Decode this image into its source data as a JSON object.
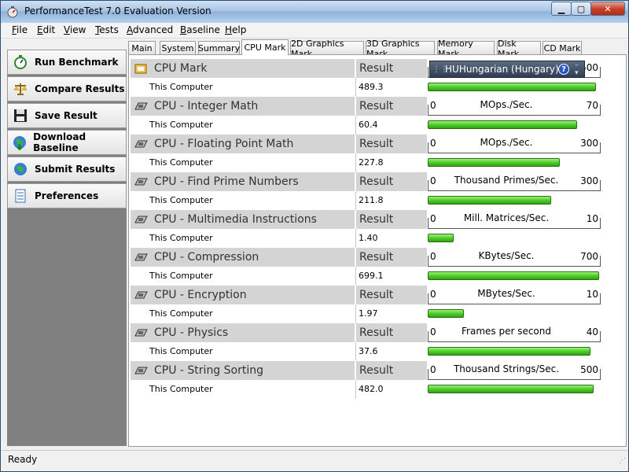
{
  "window": {
    "title": "PerformanceTest 7.0 Evaluation Version"
  },
  "menu": [
    {
      "key": "F",
      "rest": "ile"
    },
    {
      "key": "E",
      "rest": "dit"
    },
    {
      "key": "V",
      "rest": "iew"
    },
    {
      "key": "T",
      "rest": "ests"
    },
    {
      "key": "A",
      "rest": "dvanced"
    },
    {
      "key": "B",
      "rest": "aseline"
    },
    {
      "key": "H",
      "rest": "elp"
    }
  ],
  "sidebar": [
    {
      "label": "Run Benchmark",
      "icon": "stopwatch-icon"
    },
    {
      "label": "Compare Results",
      "icon": "scales-icon"
    },
    {
      "label": "Save Result",
      "icon": "floppy-disk-icon"
    },
    {
      "label": "Download Baseline",
      "icon": "globe-download-icon"
    },
    {
      "label": "Submit Results",
      "icon": "globe-upload-icon"
    },
    {
      "label": "Preferences",
      "icon": "checklist-icon"
    }
  ],
  "tabs": [
    "Main",
    "System",
    "Summary",
    "CPU Mark",
    "2D Graphics Mark",
    "3D Graphics Mark",
    "Memory Mark",
    "Disk Mark",
    "CD Mark"
  ],
  "active_tab": "CPU Mark",
  "language_bar": {
    "code": "HU",
    "name": "Hungarian (Hungary)",
    "help": "?"
  },
  "colors": {
    "bar_fill": "#4fcf2a",
    "header_bg": "#d4d4d4"
  },
  "tests": [
    {
      "name": "CPU Mark",
      "result_label": "Result",
      "computer": "This Computer",
      "value": "489.3",
      "scale_min": "0",
      "scale_unit": "",
      "scale_max": "500",
      "fill": 0.98,
      "icon": "cpu-chip-icon"
    },
    {
      "name": "CPU - Integer Math",
      "result_label": "Result",
      "computer": "This Computer",
      "value": "60.4",
      "scale_min": "0",
      "scale_unit": "MOps./Sec.",
      "scale_max": "70",
      "fill": 0.87,
      "icon": "cpu-card-icon"
    },
    {
      "name": "CPU - Floating Point Math",
      "result_label": "Result",
      "computer": "This Computer",
      "value": "227.8",
      "scale_min": "0",
      "scale_unit": "MOps./Sec.",
      "scale_max": "300",
      "fill": 0.77,
      "icon": "cpu-card-icon"
    },
    {
      "name": "CPU - Find Prime Numbers",
      "result_label": "Result",
      "computer": "This Computer",
      "value": "211.8",
      "scale_min": "0",
      "scale_unit": "Thousand Primes/Sec.",
      "scale_max": "300",
      "fill": 0.72,
      "icon": "cpu-card-icon"
    },
    {
      "name": "CPU - Multimedia Instructions",
      "result_label": "Result",
      "computer": "This Computer",
      "value": "1.40",
      "scale_min": "0",
      "scale_unit": "Mill. Matrices/Sec.",
      "scale_max": "10",
      "fill": 0.15,
      "icon": "cpu-card-icon"
    },
    {
      "name": "CPU - Compression",
      "result_label": "Result",
      "computer": "This Computer",
      "value": "699.1",
      "scale_min": "0",
      "scale_unit": "KBytes/Sec.",
      "scale_max": "700",
      "fill": 1.0,
      "icon": "cpu-card-icon"
    },
    {
      "name": "CPU - Encryption",
      "result_label": "Result",
      "computer": "This Computer",
      "value": "1.97",
      "scale_min": "0",
      "scale_unit": "MBytes/Sec.",
      "scale_max": "10",
      "fill": 0.21,
      "icon": "cpu-card-icon"
    },
    {
      "name": "CPU - Physics",
      "result_label": "Result",
      "computer": "This Computer",
      "value": "37.6",
      "scale_min": "0",
      "scale_unit": "Frames per second",
      "scale_max": "40",
      "fill": 0.95,
      "icon": "cpu-card-icon"
    },
    {
      "name": "CPU - String Sorting",
      "result_label": "Result",
      "computer": "This Computer",
      "value": "482.0",
      "scale_min": "0",
      "scale_unit": "Thousand Strings/Sec.",
      "scale_max": "500",
      "fill": 0.97,
      "icon": "cpu-card-icon"
    }
  ],
  "status": {
    "text": "Ready"
  }
}
